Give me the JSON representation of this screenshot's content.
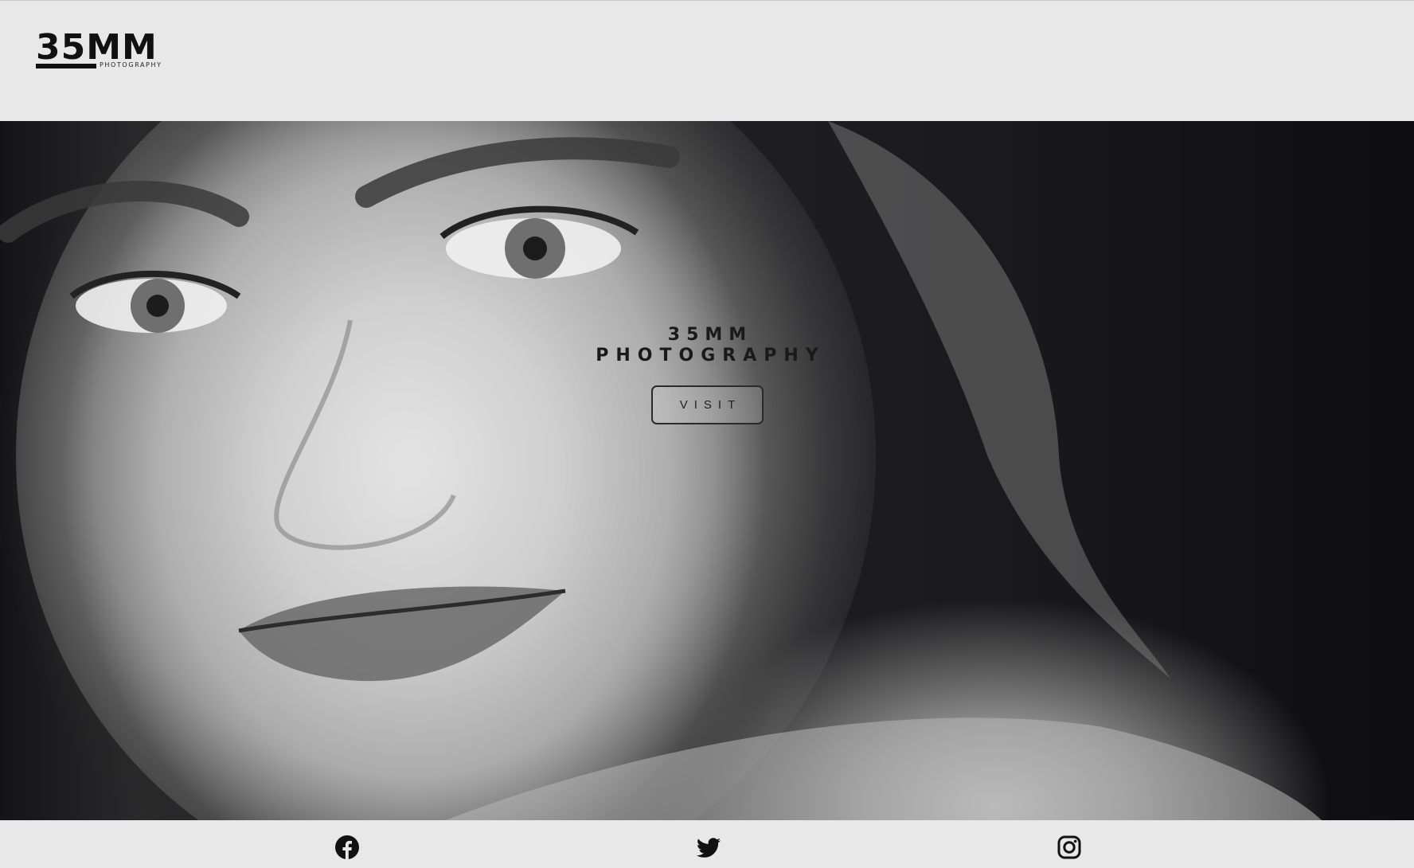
{
  "header": {
    "logo": {
      "main": "35MM",
      "sub": "PHOTOGRAPHY"
    }
  },
  "hero": {
    "title_line1": "35MM",
    "title_line2": "PHOTOGRAPHY",
    "button_label": "VISIT",
    "image_icon": "portrait-photo"
  },
  "footer": {
    "social": [
      {
        "icon": "facebook-icon"
      },
      {
        "icon": "twitter-icon"
      },
      {
        "icon": "instagram-icon"
      }
    ]
  },
  "colors": {
    "background": "#e8e8e8",
    "text": "#111111",
    "button_border": "#2a2a2a"
  }
}
